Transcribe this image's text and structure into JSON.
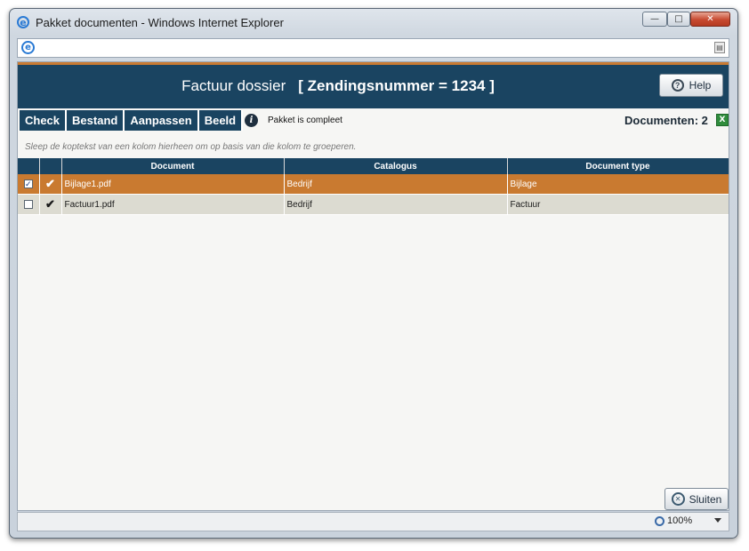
{
  "window": {
    "title": "Pakket documenten - Windows Internet Explorer",
    "minimize_label": "—",
    "maximize_label": "□",
    "close_label": "✕"
  },
  "header": {
    "title": "Factuur dossier",
    "shipment": "[ Zendingsnummer = 1234 ]",
    "help_label": "Help"
  },
  "menu": {
    "items": [
      "Check",
      "Bestand",
      "Aanpassen",
      "Beeld"
    ]
  },
  "status": {
    "message": "Pakket is compleet",
    "documents_count": "Documenten: 2"
  },
  "grid": {
    "group_hint": "Sleep de koptekst van een kolom hierheen om op basis van die kolom te groeperen.",
    "columns": [
      "Document",
      "Catalogus",
      "Document type"
    ],
    "rows": [
      {
        "checked": true,
        "document": "Bijlage1.pdf",
        "catalogus": "Bedrijf",
        "type": "Bijlage"
      },
      {
        "checked": false,
        "document": "Factuur1.pdf",
        "catalogus": "Bedrijf",
        "type": "Factuur"
      }
    ]
  },
  "footer": {
    "close_label": "Sluiten"
  },
  "statusbar": {
    "zoom": "100%"
  },
  "colors": {
    "header_bg": "#1a4461",
    "accent": "#c97a30",
    "row_bg": "#dcdbd1"
  }
}
